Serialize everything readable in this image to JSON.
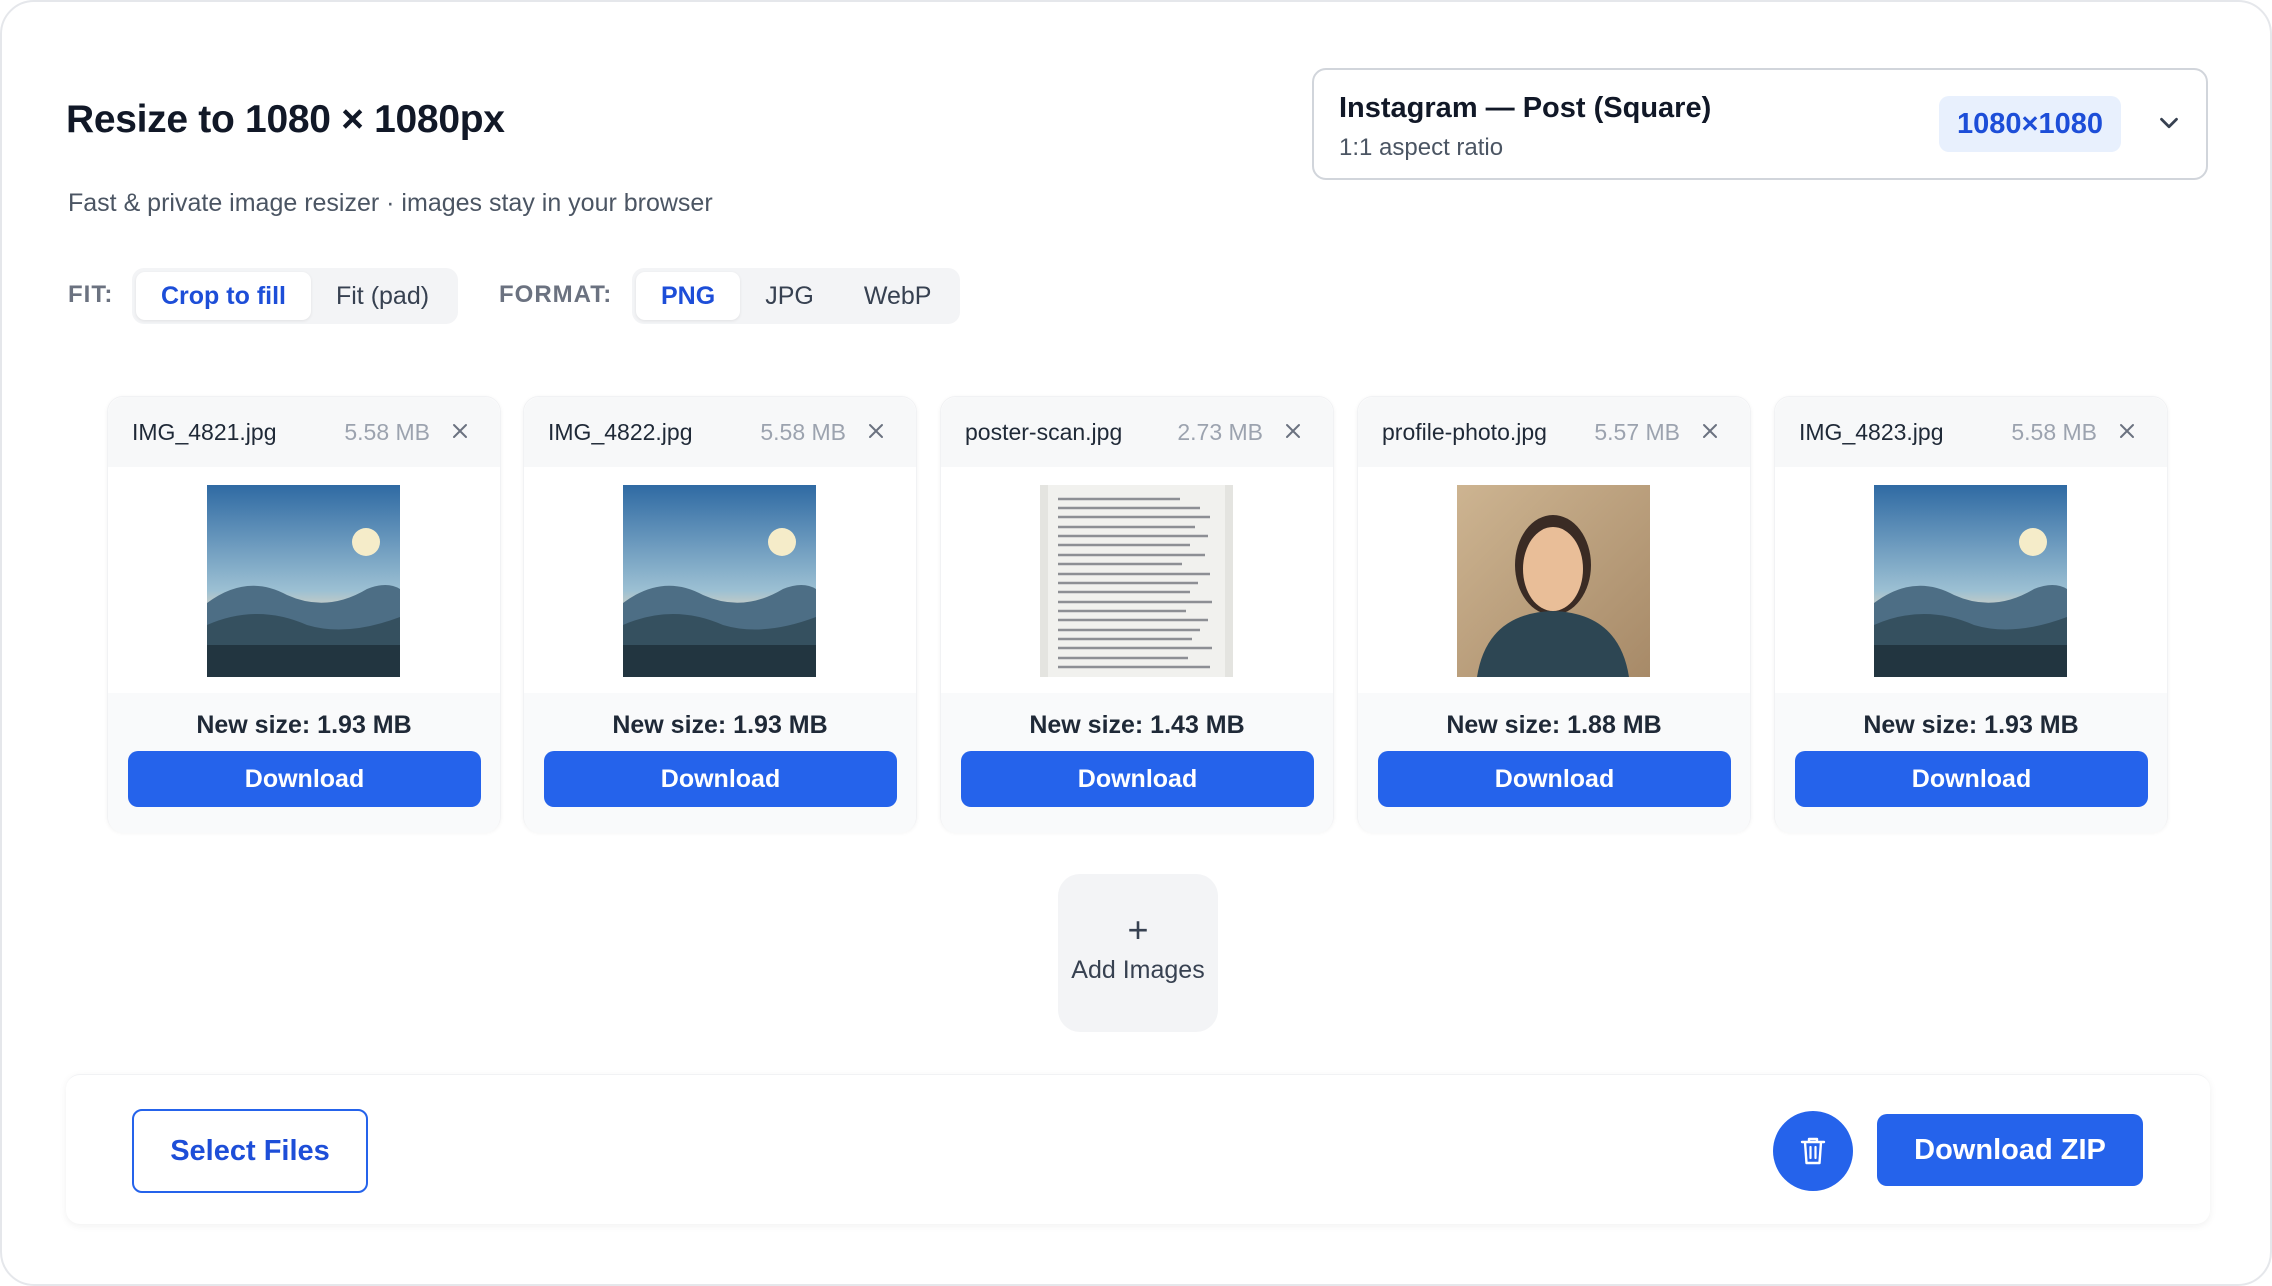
{
  "header": {
    "title": "Resize to 1080 × 1080px",
    "subtitle": "Fast & private image resizer · images stay in your browser"
  },
  "preset": {
    "name": "Instagram — Post (Square)",
    "ratio": "1:1 aspect ratio",
    "badge": "1080×1080",
    "icon": "chevron-down-icon"
  },
  "fit": {
    "label": "FIT:",
    "options": [
      "Crop to fill",
      "Fit (pad)"
    ],
    "selected": "Crop to fill"
  },
  "format": {
    "label": "FORMAT:",
    "options": [
      "PNG",
      "JPG",
      "WebP"
    ],
    "selected": "PNG"
  },
  "files": [
    {
      "name": "IMG_4821.jpg",
      "size": "5.58 MB",
      "new_size": "New size: 1.93 MB",
      "download": "Download",
      "thumb": "landscape"
    },
    {
      "name": "IMG_4822.jpg",
      "size": "5.58 MB",
      "new_size": "New size: 1.93 MB",
      "download": "Download",
      "thumb": "landscape"
    },
    {
      "name": "poster-scan.jpg",
      "size": "2.73 MB",
      "new_size": "New size: 1.43 MB",
      "download": "Download",
      "thumb": "document"
    },
    {
      "name": "profile-photo.jpg",
      "size": "5.57 MB",
      "new_size": "New size: 1.88 MB",
      "download": "Download",
      "thumb": "portrait"
    },
    {
      "name": "IMG_4823.jpg",
      "size": "5.58 MB",
      "new_size": "New size: 1.93 MB",
      "download": "Download",
      "thumb": "landscape"
    }
  ],
  "add_tile": {
    "plus": "+",
    "label": "Add Images"
  },
  "footer": {
    "select_files": "Select Files",
    "trash_icon": "trash-icon",
    "download_zip": "Download ZIP"
  },
  "colors": {
    "accent": "#2563eb",
    "accent_text": "#1d4ed8",
    "badge_bg": "#e8f0fd"
  }
}
